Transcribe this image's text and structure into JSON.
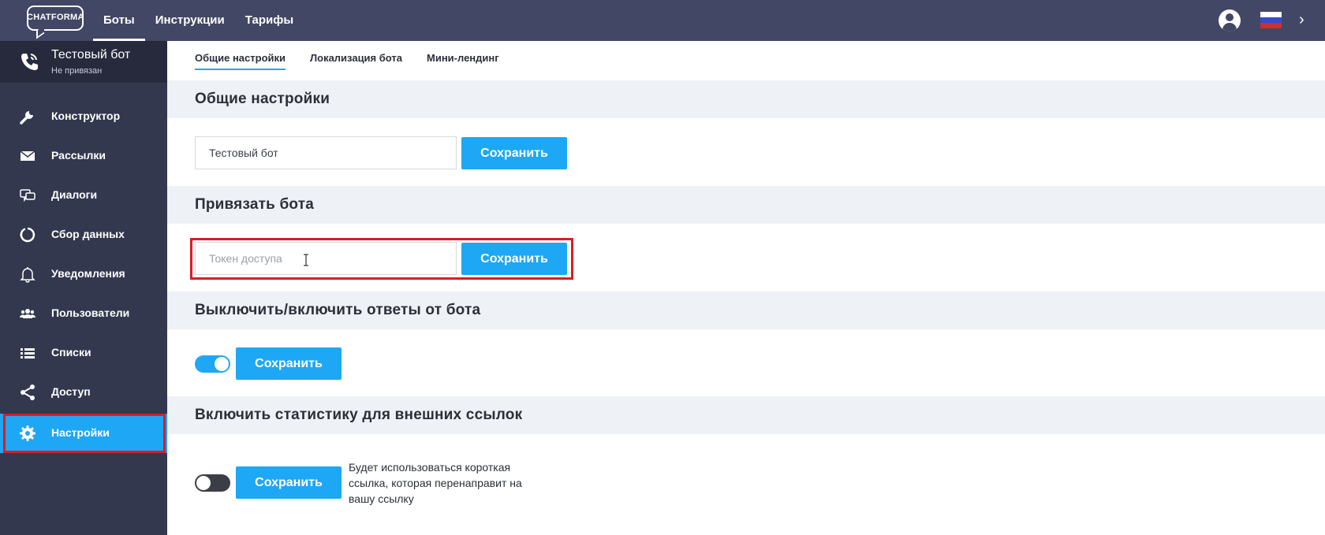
{
  "topbar": {
    "logo_text": "CHATFORMA",
    "nav": [
      {
        "label": "Боты",
        "active": true
      },
      {
        "label": "Инструкции",
        "active": false
      },
      {
        "label": "Тарифы",
        "active": false
      }
    ],
    "icons": {
      "account": "user-circle-icon",
      "language": "russia-flag-icon",
      "more": "chevron-right-icon"
    },
    "chevron_glyph": "›"
  },
  "sidebar": {
    "bot_name": "Тестовый бот",
    "bot_status": "Не привязан",
    "items": [
      {
        "label": "Конструктор",
        "icon": "wrench-icon"
      },
      {
        "label": "Рассылки",
        "icon": "envelope-icon"
      },
      {
        "label": "Диалоги",
        "icon": "chat-bubbles-icon"
      },
      {
        "label": "Сбор данных",
        "icon": "circular-arrows-icon"
      },
      {
        "label": "Уведомления",
        "icon": "bell-icon"
      },
      {
        "label": "Пользователи",
        "icon": "users-icon"
      },
      {
        "label": "Списки",
        "icon": "list-icon"
      },
      {
        "label": "Доступ",
        "icon": "share-icon"
      },
      {
        "label": "Настройки",
        "icon": "gear-icon",
        "active": true
      }
    ]
  },
  "main": {
    "tabs": [
      {
        "label": "Общие настройки",
        "active": true
      },
      {
        "label": "Локализация бота",
        "active": false
      },
      {
        "label": "Мини-лендинг",
        "active": false
      }
    ],
    "general": {
      "title": "Общие настройки",
      "name_value": "Тестовый бот",
      "save_label": "Сохранить"
    },
    "bind": {
      "title": "Привязать бота",
      "token_placeholder": "Токен доступа",
      "token_value": "",
      "save_label": "Сохранить"
    },
    "replies": {
      "title": "Выключить/включить ответы от бота",
      "enabled": true,
      "save_label": "Сохранить"
    },
    "stats": {
      "title": "Включить статистику для внешних ссылок",
      "enabled": false,
      "save_label": "Сохранить",
      "note": "Будет использоваться короткая ссылка, которая перенаправит на вашу ссылку"
    }
  },
  "colors": {
    "topbar": "#414764",
    "sidebar": "#33384f",
    "sidebar_header": "#262a3c",
    "accent": "#1ea7f5",
    "highlight": "#d81e24",
    "section_band": "#eef1f5"
  }
}
